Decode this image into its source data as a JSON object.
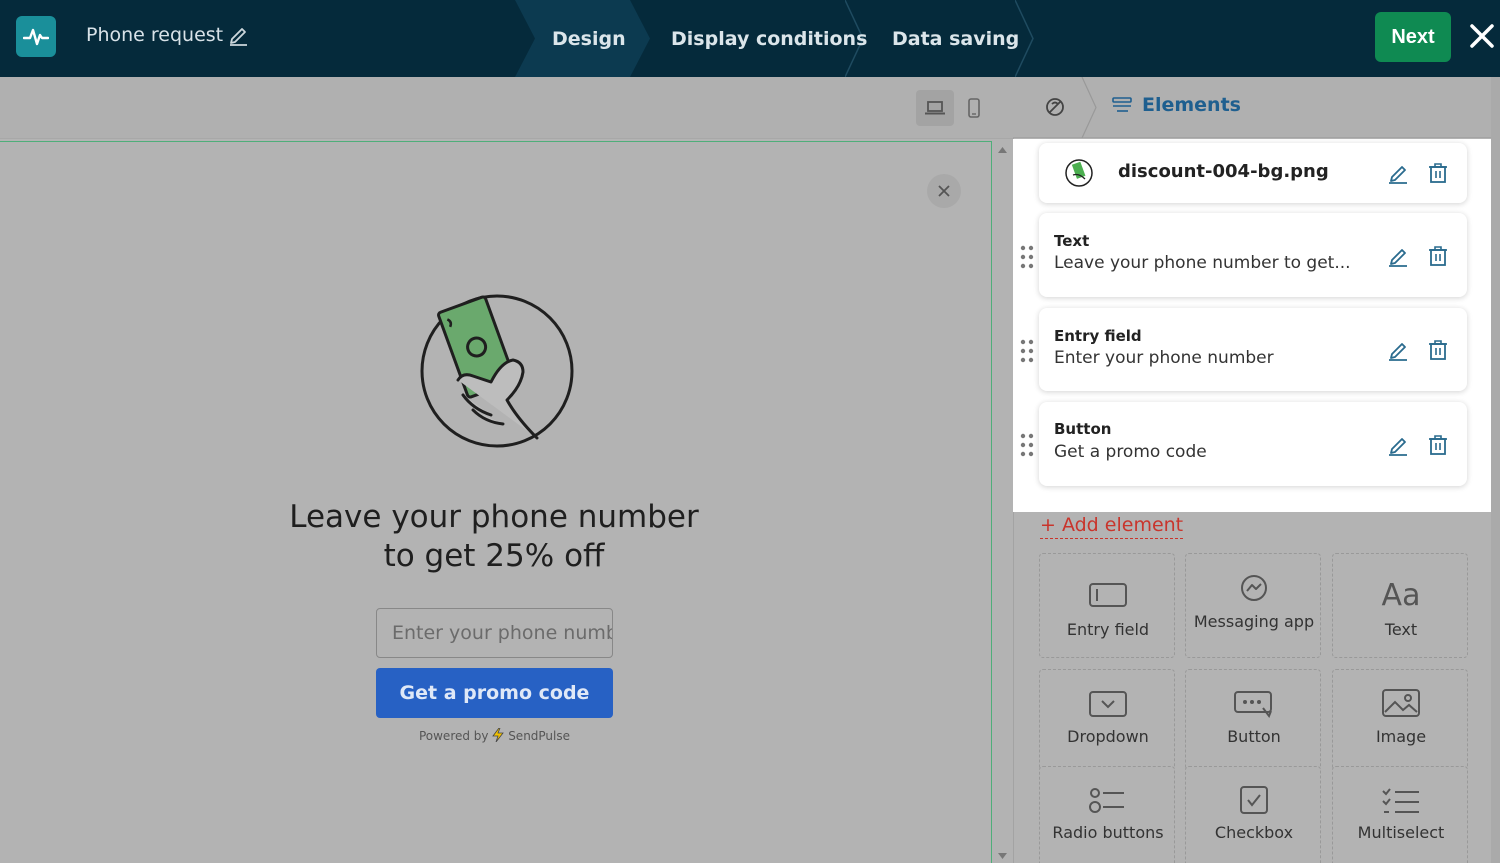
{
  "header": {
    "title": "Phone request",
    "steps": [
      "Design",
      "Display conditions",
      "Data saving"
    ],
    "active_step": "Design",
    "next_label": "Next"
  },
  "popup": {
    "headline_line1": "Leave your phone number",
    "headline_line2": "to get 25% off",
    "input_placeholder": "Enter your phone number",
    "button_label": "Get a promo code",
    "powered_by": "Powered by",
    "brand": "SendPulse"
  },
  "panel": {
    "title": "Elements",
    "items": [
      {
        "type": "",
        "value": "discount-004-bg.png"
      },
      {
        "type": "Text",
        "value": "Leave your phone number to get..."
      },
      {
        "type": "Entry field",
        "value": "Enter your phone number"
      },
      {
        "type": "Button",
        "value": "Get a promo code"
      }
    ],
    "add_label": "+ Add element",
    "tiles": [
      {
        "label": "Entry field",
        "icon": "entry-field-icon"
      },
      {
        "label": "Messaging app",
        "icon": "messaging-app-icon"
      },
      {
        "label": "Text",
        "icon": "text-icon"
      },
      {
        "label": "Dropdown",
        "icon": "dropdown-icon"
      },
      {
        "label": "Button",
        "icon": "button-icon"
      },
      {
        "label": "Image",
        "icon": "image-icon"
      },
      {
        "label": "Radio buttons",
        "icon": "radio-buttons-icon"
      },
      {
        "label": "Checkbox",
        "icon": "checkbox-icon"
      },
      {
        "label": "Multiselect",
        "icon": "multiselect-icon"
      }
    ]
  },
  "colors": {
    "topbar": "#052a3b",
    "next_button": "#0f8a52",
    "primary_button": "#2761c4",
    "accent_link": "#c9352c",
    "elements_title": "#1f5f8f"
  }
}
